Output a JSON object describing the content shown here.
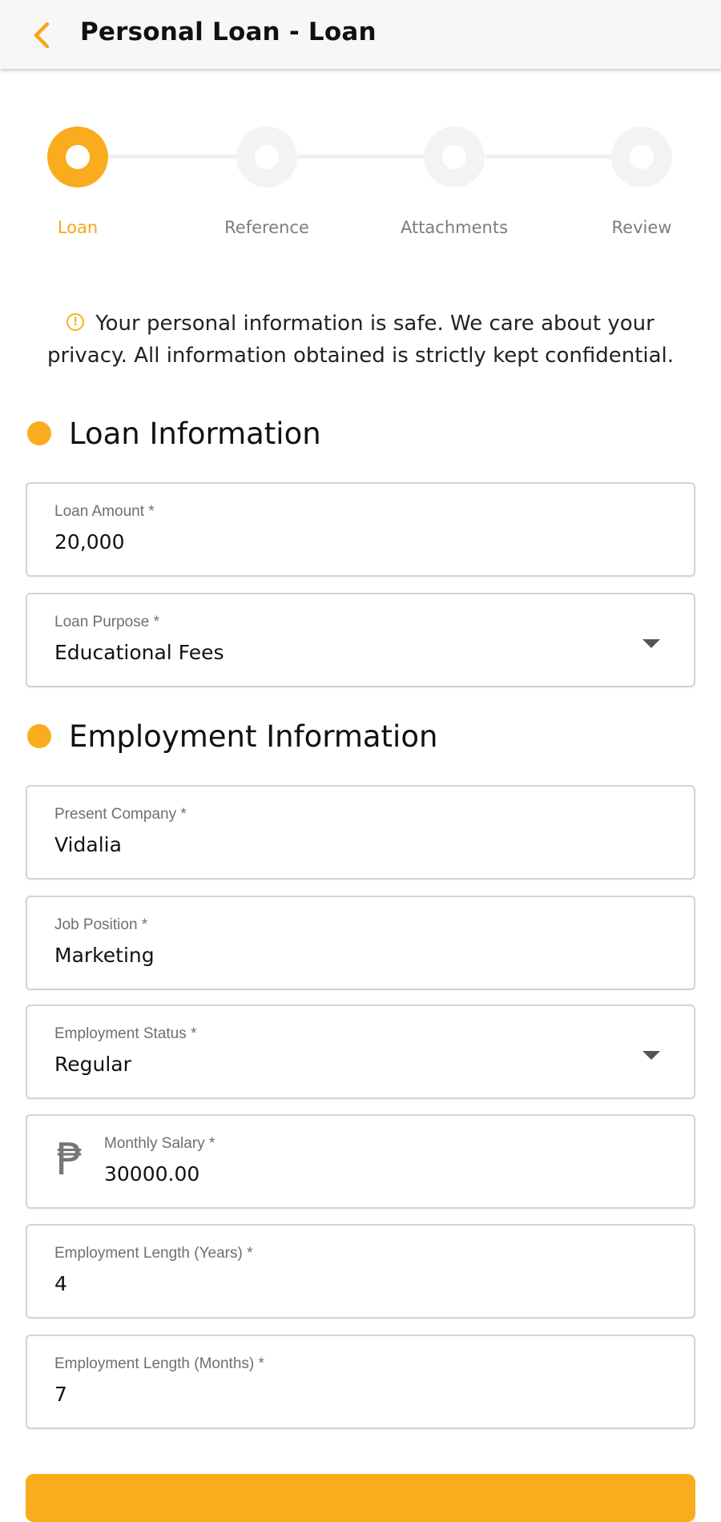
{
  "header": {
    "title": "Personal Loan - Loan",
    "back_icon": "chevron-left-icon",
    "accent_color": "#f9ac1d"
  },
  "stepper": {
    "steps": [
      {
        "label": "Loan",
        "active": true
      },
      {
        "label": "Reference",
        "active": false
      },
      {
        "label": "Attachments",
        "active": false
      },
      {
        "label": "Review",
        "active": false
      }
    ]
  },
  "notice": {
    "icon": "info-icon",
    "text": "Your personal information is safe. We care about your privacy. All information obtained is strictly kept confidential."
  },
  "loan_section": {
    "title": "Loan Information",
    "fields": {
      "amount": {
        "label": "Loan Amount *",
        "value": "20,000"
      },
      "purpose": {
        "label": "Loan Purpose *",
        "value": "Educational Fees"
      }
    }
  },
  "employment_section": {
    "title": "Employment Information",
    "fields": {
      "company": {
        "label": "Present Company *",
        "value": "Vidalia"
      },
      "position": {
        "label": "Job Position *",
        "value": "Marketing"
      },
      "status": {
        "label": "Employment Status *",
        "value": "Regular"
      },
      "salary": {
        "label": "Monthly Salary *",
        "value": "30000.00",
        "currency_icon": "peso-icon",
        "currency_symbol": "₱"
      },
      "years": {
        "label": "Employment Length (Years) *",
        "value": "4"
      },
      "months": {
        "label": "Employment Length (Months) *",
        "value": "7"
      }
    }
  }
}
